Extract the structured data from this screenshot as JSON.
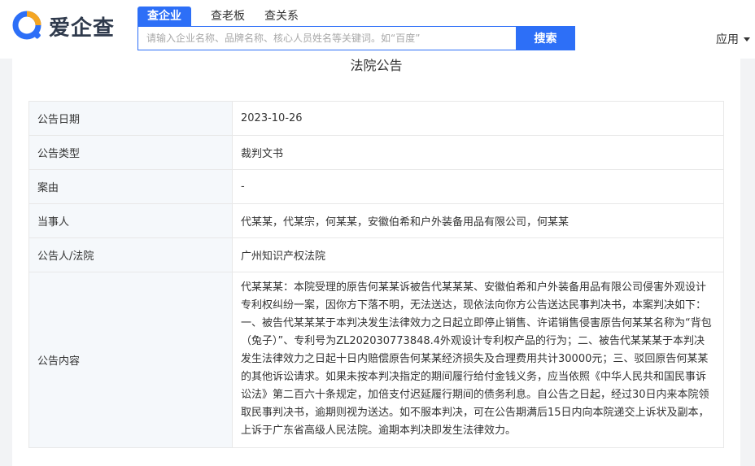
{
  "header": {
    "logo_text": "爱企查",
    "tabs": [
      "查企业",
      "查老板",
      "查关系"
    ],
    "search_placeholder": "请输入企业名称、品牌名称、核心人员姓名等关键词。如“百度”",
    "search_button": "搜索",
    "apps_label": "应用"
  },
  "page": {
    "title": "法院公告",
    "rows": [
      {
        "label": "公告日期",
        "value": "2023-10-26"
      },
      {
        "label": "公告类型",
        "value": "裁判文书"
      },
      {
        "label": "案由",
        "value": "-"
      },
      {
        "label": "当事人",
        "value": "代某某，代某宗，何某某，安徽伯希和户外装备用品有限公司，何某某"
      },
      {
        "label": "公告人/法院",
        "value": "广州知识产权法院"
      },
      {
        "label": "公告内容",
        "value": "代某某某：本院受理的原告何某某诉被告代某某某、安徽伯希和户外装备用品有限公司侵害外观设计专利权纠纷一案，因你方下落不明，无法送达，现依法向你方公告送达民事判决书，本案判决如下：一、被告代某某某于本判决发生法律效力之日起立即停止销售、许诺销售侵害原告何某某名称为“背包（兔子）”、专利号为ZL202030773848.4外观设计专利权产品的行为；二、被告代某某某于本判决发生法律效力之日起十日内赔偿原告何某某经济损失及合理费用共计30000元；三、驳回原告何某某的其他诉讼请求。如果未按本判决指定的期间履行给付金钱义务，应当依照《中华人民共和国民事诉讼法》第二百六十条规定，加倍支付迟延履行期间的债务利息。自公告之日起，经过30日内来本院领取民事判决书，逾期则视为送达。如不服本判决，可在公告期满后15日内向本院递交上诉状及副本，上诉于广东省高级人民法院。逾期本判决即发生法律效力。"
      }
    ]
  },
  "colors": {
    "accent": "#2d6ff7",
    "logo_orange": "#f5a623",
    "label_bg": "#f5f8fb"
  }
}
